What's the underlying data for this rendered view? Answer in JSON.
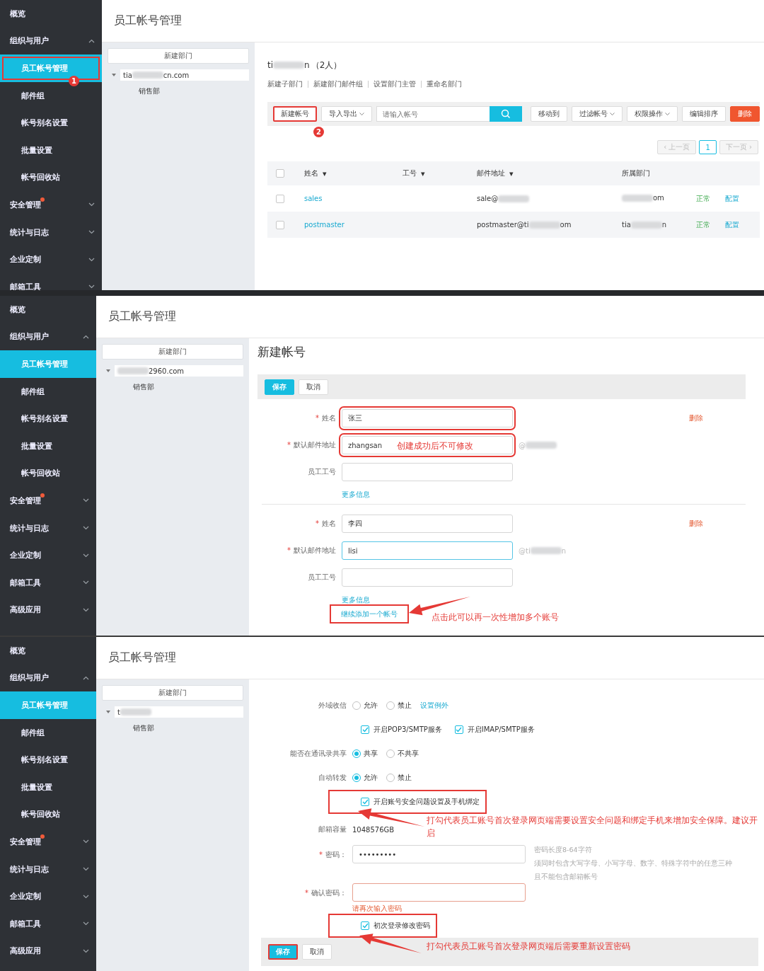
{
  "panels": [
    {
      "sidebar": [
        {
          "kind": "link",
          "label": "概览"
        },
        {
          "kind": "group",
          "label": "组织与用户",
          "expanded": true,
          "alert": false
        },
        {
          "kind": "sub",
          "label": "员工帐号管理",
          "selected": true,
          "highlight": true,
          "badge": "1"
        },
        {
          "kind": "sub",
          "label": "邮件组",
          "selected": false
        },
        {
          "kind": "sub",
          "label": "帐号别名设置",
          "selected": false
        },
        {
          "kind": "sub",
          "label": "批量设置",
          "selected": false
        },
        {
          "kind": "sub",
          "label": "帐号回收站",
          "selected": false
        },
        {
          "kind": "group",
          "label": "安全管理",
          "expanded": false,
          "alert": true
        },
        {
          "kind": "group",
          "label": "统计与日志",
          "expanded": false,
          "alert": false
        },
        {
          "kind": "group",
          "label": "企业定制",
          "expanded": false,
          "alert": false
        },
        {
          "kind": "group",
          "label": "邮箱工具",
          "expanded": false,
          "alert": false
        }
      ],
      "page_title": "员工帐号管理",
      "new_dept_button": "新建部门",
      "tree": {
        "root": {
          "before": "tia",
          "after": "cn.com"
        },
        "expanded": true,
        "children": [
          {
            "label": "销售部"
          }
        ]
      },
      "content": {
        "kind": "account_list",
        "dept_title": {
          "before": "ti",
          "after": "n"
        },
        "member_count": "（2人）",
        "dept_links": [
          "新建子部门",
          "新建部门邮件组",
          "设置部门主管",
          "重命名部门"
        ],
        "left_buttons": [
          {
            "label": "新建帐号",
            "dropdown": false,
            "highlight": true,
            "badge": "2"
          },
          {
            "label": "导入导出",
            "dropdown": true,
            "highlight": false
          }
        ],
        "search": {
          "placeholder": "请输入帐号"
        },
        "right_buttons": [
          {
            "label": "移动到",
            "kind": "default",
            "dropdown": false
          },
          {
            "label": "过滤帐号",
            "kind": "default",
            "dropdown": true
          },
          {
            "label": "权限操作",
            "kind": "default",
            "dropdown": true
          },
          {
            "label": "编辑排序",
            "kind": "default",
            "dropdown": false
          },
          {
            "label": "删除",
            "kind": "danger",
            "dropdown": false
          }
        ],
        "pagination": [
          {
            "label": "‹ 上一页",
            "disabled": true,
            "selected": false
          },
          {
            "label": "1",
            "disabled": false,
            "selected": true
          },
          {
            "label": "下一页 ›",
            "disabled": true,
            "selected": false
          }
        ],
        "columns": [
          {
            "label": "姓名",
            "sort_mark": "▾"
          },
          {
            "label": "工号",
            "sort_mark": "▾"
          },
          {
            "label": "邮件地址",
            "sort_mark": "▾"
          },
          {
            "label": "所属部门"
          }
        ],
        "header_checked": false,
        "rows": [
          {
            "checked": false,
            "name": "sales",
            "email": {
              "before": "sale@"
            },
            "dept": {
              "after": "om"
            },
            "status": "正常",
            "action": "配置"
          },
          {
            "checked": false,
            "name": "postmaster",
            "email": {
              "before": "postmaster@ti",
              "after": "om"
            },
            "dept": {
              "before": "tia",
              "after": "n"
            },
            "status": "正常",
            "action": "配置"
          }
        ]
      }
    },
    {
      "sidebar": [
        {
          "kind": "link",
          "label": "概览"
        },
        {
          "kind": "group",
          "label": "组织与用户",
          "expanded": true,
          "alert": false
        },
        {
          "kind": "sub",
          "label": "员工帐号管理",
          "selected": true
        },
        {
          "kind": "sub",
          "label": "邮件组",
          "selected": false
        },
        {
          "kind": "sub",
          "label": "帐号别名设置",
          "selected": false
        },
        {
          "kind": "sub",
          "label": "批量设置",
          "selected": false
        },
        {
          "kind": "sub",
          "label": "帐号回收站",
          "selected": false
        },
        {
          "kind": "group",
          "label": "安全管理",
          "expanded": false,
          "alert": true
        },
        {
          "kind": "group",
          "label": "统计与日志",
          "expanded": false,
          "alert": false
        },
        {
          "kind": "group",
          "label": "企业定制",
          "expanded": false,
          "alert": false
        },
        {
          "kind": "group",
          "label": "邮箱工具",
          "expanded": false,
          "alert": false
        },
        {
          "kind": "group",
          "label": "高级应用",
          "expanded": false,
          "alert": false
        }
      ],
      "page_title": "员工帐号管理",
      "new_dept_button": "新建部门",
      "tree": {
        "root": {
          "after": "2960.com"
        },
        "expanded": true,
        "children": [
          {
            "label": "销售部"
          }
        ]
      },
      "content": {
        "kind": "new_account",
        "title": "新建帐号",
        "actions": [
          {
            "label": "保存",
            "kind": "primary",
            "highlight": false
          },
          {
            "label": "取消",
            "kind": "default",
            "highlight": false
          }
        ],
        "accounts": [
          {
            "delete": "删除",
            "more_link": "更多信息",
            "fields": [
              {
                "label": "姓名",
                "required_mark": "*",
                "value": "张三",
                "highlight": true,
                "focused": false
              },
              {
                "label": "默认邮件地址",
                "required_mark": "*",
                "value": "zhangsan",
                "highlight": true,
                "focused": false,
                "note": "创建成功后不可修改",
                "domain": {
                  "before": "@"
                }
              },
              {
                "label": "员工工号",
                "highlight": false,
                "focused": false
              }
            ]
          },
          {
            "delete": "删除",
            "more_link": "更多信息",
            "fields": [
              {
                "label": "姓名",
                "required_mark": "*",
                "value": "李四",
                "highlight": false,
                "focused": false
              },
              {
                "label": "默认邮件地址",
                "required_mark": "*",
                "value": "lisi",
                "highlight": false,
                "focused": true,
                "domain": {
                  "before": "@ti",
                  "after": "n"
                }
              },
              {
                "label": "员工工号",
                "highlight": false,
                "focused": false
              }
            ]
          }
        ],
        "add_link": {
          "label": "继续添加一个帐号",
          "highlight": true
        },
        "annotation": "点击此可以再一次性增加多个账号"
      }
    },
    {
      "sidebar": [
        {
          "kind": "link",
          "label": "概览"
        },
        {
          "kind": "group",
          "label": "组织与用户",
          "expanded": true,
          "alert": false
        },
        {
          "kind": "sub",
          "label": "员工帐号管理",
          "selected": true
        },
        {
          "kind": "sub",
          "label": "邮件组",
          "selected": false
        },
        {
          "kind": "sub",
          "label": "帐号别名设置",
          "selected": false
        },
        {
          "kind": "sub",
          "label": "批量设置",
          "selected": false
        },
        {
          "kind": "sub",
          "label": "帐号回收站",
          "selected": false
        },
        {
          "kind": "group",
          "label": "安全管理",
          "expanded": false,
          "alert": true
        },
        {
          "kind": "group",
          "label": "统计与日志",
          "expanded": false,
          "alert": false
        },
        {
          "kind": "group",
          "label": "企业定制",
          "expanded": false,
          "alert": false
        },
        {
          "kind": "group",
          "label": "邮箱工具",
          "expanded": false,
          "alert": false
        },
        {
          "kind": "group",
          "label": "高级应用",
          "expanded": false,
          "alert": false
        }
      ],
      "page_title": "员工帐号管理",
      "new_dept_button": "新建部门",
      "tree": {
        "root": {
          "before": "t"
        },
        "expanded": true,
        "children": [
          {
            "label": "销售部"
          }
        ]
      },
      "content": {
        "kind": "account_options",
        "rows": [
          {
            "kind": "radio",
            "label": "外域收信",
            "options": [
              {
                "label": "允许",
                "selected": false
              },
              {
                "label": "禁止",
                "selected": false
              }
            ],
            "link": "设置例外"
          },
          {
            "kind": "checks",
            "options": [
              {
                "label": "开启POP3/SMTP服务",
                "checked": true
              },
              {
                "label": "开启IMAP/SMTP服务",
                "checked": true
              }
            ]
          },
          {
            "kind": "radio",
            "label": "能否在通讯录共享",
            "options": [
              {
                "label": "共享",
                "selected": true
              },
              {
                "label": "不共享",
                "selected": false
              }
            ]
          },
          {
            "kind": "radio",
            "label": "自动转发",
            "options": [
              {
                "label": "允许",
                "selected": true
              },
              {
                "label": "禁止",
                "selected": false
              }
            ]
          },
          {
            "kind": "checks",
            "highlight": true,
            "options": [
              {
                "label": "开启账号安全问题设置及手机绑定",
                "checked": true
              }
            ]
          },
          {
            "kind": "text",
            "label": "邮箱容量",
            "value": "1048576GB"
          },
          {
            "kind": "password",
            "label": "密码：",
            "required_mark": "*",
            "value": "•••••••••",
            "error": false,
            "hints": [
              "密码长度8-64字符",
              "须同时包含大写字母、小写字母、数字、特殊字符中的任意三种",
              "且不能包含邮箱帐号"
            ]
          },
          {
            "kind": "password",
            "label": "确认密码：",
            "required_mark": "*",
            "error": true,
            "error_text": "请再次输入密码"
          },
          {
            "kind": "checks",
            "highlight": true,
            "options": [
              {
                "label": "初次登录修改密码",
                "checked": true
              }
            ]
          }
        ],
        "actions": [
          {
            "label": "保存",
            "kind": "primary",
            "highlight": true
          },
          {
            "label": "取消",
            "kind": "default",
            "highlight": false
          }
        ],
        "annotations": [
          "打勾代表员工账号首次登录网页端需要设置安全问题和绑定手机来增加安全保障。建议开启",
          "打勾代表员工账号首次登录网页端后需要重新设置密码"
        ]
      }
    }
  ]
}
